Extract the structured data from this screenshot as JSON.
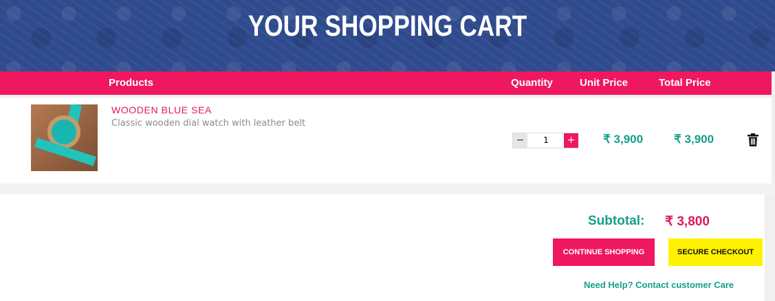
{
  "page": {
    "title": "YOUR SHOPPING CART"
  },
  "table": {
    "headers": {
      "products": "Products",
      "quantity": "Quantity",
      "unit_price": "Unit Price",
      "total_price": "Total Price"
    }
  },
  "cart": {
    "items": [
      {
        "name": "WOODEN BLUE SEA",
        "description": "Classic wooden dial watch with leather belt",
        "quantity": "1",
        "quantity_minus": "−",
        "quantity_plus": "+",
        "unit_price": "₹ 3,900",
        "total_price": "₹ 3,900",
        "remove_icon": "trash-icon",
        "image": "wooden-watch-thumbnail"
      }
    ]
  },
  "summary": {
    "subtotal_label": "Subtotal:",
    "subtotal_value": "₹ 3,800",
    "continue_label": "CONTINUE SHOPPING",
    "checkout_label": "SECURE CHECKOUT",
    "help_text": "Need Help? Contact customer Care"
  },
  "colors": {
    "banner": "#2f4b8e",
    "accent_pink": "#ef1860",
    "accent_teal": "#14a08a",
    "checkout_yellow": "#fff200"
  }
}
